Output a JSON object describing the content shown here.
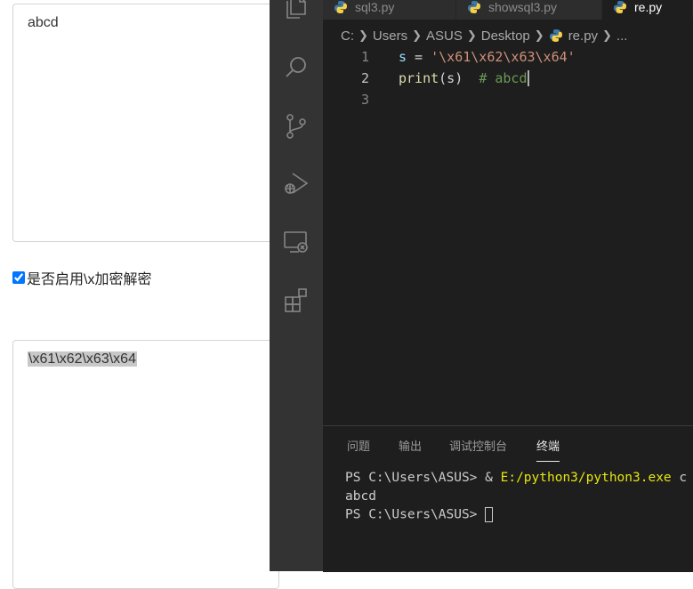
{
  "web": {
    "top_textarea_value": "abcd",
    "checkbox_label": "是否启用\\x加密解密",
    "checkbox_checked": true,
    "bottom_textarea_value": "\\x61\\x62\\x63\\x64"
  },
  "vscode": {
    "activity_icons": [
      "files-icon",
      "search-icon",
      "source-control-icon",
      "run-debug-icon",
      "remote-explorer-icon",
      "extensions-icon"
    ],
    "tabs": [
      {
        "label": "sql3.py",
        "active": false
      },
      {
        "label": "showsql3.py",
        "active": false
      },
      {
        "label": "re.py",
        "active": true
      }
    ],
    "breadcrumb": {
      "parts": [
        "C:",
        "Users",
        "ASUS",
        "Desktop"
      ],
      "file": "re.py",
      "more": "..."
    },
    "editor": {
      "lines": [
        {
          "number": "1",
          "var": "s",
          "op": " = ",
          "str": "'\\x61\\x62\\x63\\x64'"
        },
        {
          "number": "2",
          "fn": "print",
          "args": "(s)",
          "comment": "# abcd"
        },
        {
          "number": "3"
        }
      ]
    },
    "panel": {
      "tabs": [
        "问题",
        "输出",
        "调试控制台",
        "终端"
      ],
      "active_tab": "终端",
      "terminal": {
        "line1_prompt": "PS C:\\Users\\ASUS> & ",
        "line1_exe": "E:/python3/python3.exe",
        "line1_rest": " c",
        "line2": "abcd",
        "line3_prompt": "PS C:\\Users\\ASUS> "
      }
    },
    "colors": {
      "editor_bg": "#1e1e1e",
      "activity_bg": "#333333",
      "string": "#ce9178",
      "comment": "#6a9955",
      "function": "#dcdcaa",
      "variable": "#9cdcfe"
    }
  }
}
